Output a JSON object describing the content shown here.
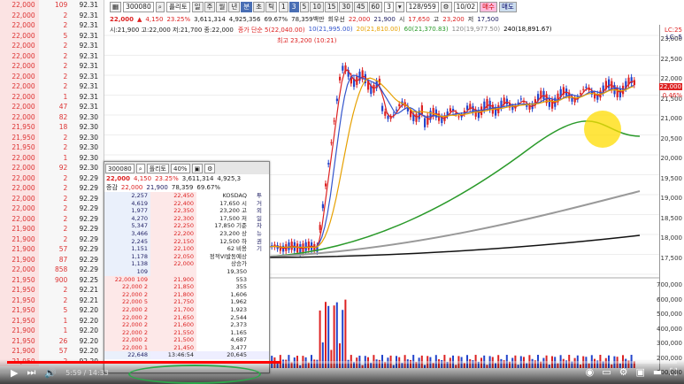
{
  "left_panel": {
    "rows": [
      [
        "22,000",
        "109",
        "92.31"
      ],
      [
        "22,000",
        "2",
        "92.31"
      ],
      [
        "22,000",
        "2",
        "92.31"
      ],
      [
        "22,000",
        "5",
        "92.31"
      ],
      [
        "22,000",
        "2",
        "92.31"
      ],
      [
        "22,000",
        "2",
        "92.31"
      ],
      [
        "22,000",
        "2",
        "92.31"
      ],
      [
        "22,000",
        "2",
        "92.31"
      ],
      [
        "22,000",
        "2",
        "92.31"
      ],
      [
        "22,000",
        "1",
        "92.31"
      ],
      [
        "22,000",
        "47",
        "92.31"
      ],
      [
        "22,000",
        "82",
        "92.30"
      ],
      [
        "21,950",
        "18",
        "92.30"
      ],
      [
        "21,950",
        "2",
        "92.30"
      ],
      [
        "21,950",
        "2",
        "92.30"
      ],
      [
        "22,000",
        "1",
        "92.30"
      ],
      [
        "22,000",
        "92",
        "92.30"
      ],
      [
        "22,000",
        "2",
        "92.29"
      ],
      [
        "22,000",
        "2",
        "92.29"
      ],
      [
        "22,000",
        "2",
        "92.29"
      ],
      [
        "22,000",
        "2",
        "92.29"
      ],
      [
        "22,000",
        "2",
        "92.29"
      ],
      [
        "21,900",
        "2",
        "92.29"
      ],
      [
        "21,900",
        "2",
        "92.29"
      ],
      [
        "21,900",
        "57",
        "92.29"
      ],
      [
        "21,900",
        "87",
        "92.29"
      ],
      [
        "22,000",
        "858",
        "92.29"
      ],
      [
        "21,950",
        "900",
        "92.25"
      ],
      [
        "21,950",
        "2",
        "92.21"
      ],
      [
        "21,950",
        "2",
        "92.21"
      ],
      [
        "21,950",
        "5",
        "92.20"
      ],
      [
        "21,950",
        "1",
        "92.20"
      ],
      [
        "21,900",
        "1",
        "92.20"
      ],
      [
        "21,950",
        "26",
        "92.20"
      ],
      [
        "21,900",
        "57",
        "92.20"
      ],
      [
        "21,950",
        "2",
        "92.20"
      ]
    ]
  },
  "toolbar": {
    "code": "300080",
    "name": "플리토",
    "periods": [
      "일",
      "주",
      "월",
      "년",
      "분",
      "초",
      "틱"
    ],
    "intervals": [
      "1",
      "3",
      "5",
      "10",
      "15",
      "30",
      "45",
      "60"
    ],
    "count": "3",
    "page": "128/959",
    "date": "10/02",
    "buy": "매수",
    "sell": "매도"
  },
  "quote": {
    "price": "22,000",
    "change": "4,150",
    "pct": "23.25%",
    "volume": "3,611,314",
    "vol2": "4,925,356",
    "ratio": "69.67%",
    "amount": "78,359백만",
    "tag": "회우선",
    "open_label": "시",
    "open": "17,650",
    "high_label": "고",
    "high": "23,200",
    "low_label": "저",
    "low": "17,500",
    "cur": "22,000",
    "cur2": "21,900"
  },
  "ohlc": {
    "text": "시:21,900 고:22,000 저:21,700 종:22,000"
  },
  "ma_legend": [
    {
      "text": "종가 단순 5(22,040.00)",
      "color": "#d22"
    },
    {
      "text": "10(21,995.00)",
      "color": "#3355cc"
    },
    {
      "text": "20(21,810.00)",
      "color": "#e6a000"
    },
    {
      "text": "60(21,370.83)",
      "color": "#2a9a2a"
    },
    {
      "text": "120(19,977.50)",
      "color": "#888888"
    },
    {
      "text": "240(18,891.67)",
      "color": "#000000"
    }
  ],
  "high_label": "최고 23,200 (10:21)",
  "yaxis": {
    "labels": [
      "23,000",
      "22,500",
      "22,000",
      "21,500",
      "21,000",
      "20,500",
      "20,000",
      "19,500",
      "19,000",
      "18,500",
      "18,000",
      "17,500",
      "700,000",
      "600,000",
      "500,000",
      "400,000",
      "300,000",
      "200,000",
      "100,000"
    ],
    "current": "22,000",
    "pct": "0.46%",
    "top": "LC:25",
    "top2": "LC:-5"
  },
  "xaxis": {
    "label": "10"
  },
  "mini": {
    "code": "300080",
    "name": "플리토",
    "ratio_tag": "40%",
    "price": "22,000",
    "change": "4,150",
    "pct": "23.25%",
    "volume": "3,611,314",
    "vol2": "4,925,3",
    "label_prev": "증감",
    "cur_a": "22,000",
    "cur_b": "21,900",
    "amount": "78,359",
    "ratio": "69.67%",
    "asks": [
      [
        "2,257",
        "22,450"
      ],
      [
        "4,619",
        "22,400"
      ],
      [
        "1,977",
        "22,350"
      ],
      [
        "4,270",
        "22,300"
      ],
      [
        "5,347",
        "22,250"
      ],
      [
        "3,466",
        "22,200"
      ],
      [
        "2,245",
        "22,150"
      ],
      [
        "1,151",
        "22,100"
      ],
      [
        "1,178",
        "22,050"
      ],
      [
        "1,138",
        "22,000"
      ]
    ],
    "info": [
      "KOSDAQ",
      "17,650 시",
      "23,200 고",
      "17,500 저",
      "17,850 기준",
      "23,200 상",
      "12,500 하",
      "62 비용",
      "정적VI발동예상",
      "상승가",
      "하락가"
    ],
    "side_tabs": [
      "투",
      "거",
      "외",
      "일",
      "차",
      "뉴",
      "권",
      "기"
    ],
    "bid_count": "109",
    "lowrate": "19,350",
    "ticks": [
      [
        "22,000",
        "109",
        "21,900",
        "553"
      ],
      [
        "22,000",
        "2",
        "21,850",
        "355"
      ],
      [
        "22,000",
        "2",
        "21,800",
        "1,606"
      ],
      [
        "22,000",
        "5",
        "21,750",
        "1,962"
      ],
      [
        "22,000",
        "2",
        "21,700",
        "1,923"
      ],
      [
        "22,000",
        "2",
        "21,650",
        "2,544"
      ],
      [
        "22,000",
        "2",
        "21,600",
        "2,373"
      ],
      [
        "22,000",
        "2",
        "21,550",
        "1,165"
      ],
      [
        "22,000",
        "2",
        "21,500",
        "4,687"
      ],
      [
        "22,000",
        "1",
        "21,450",
        "3,477"
      ]
    ],
    "footer": [
      "22,648",
      "13:46:54",
      "20,645"
    ]
  },
  "player": {
    "time": "5:59 / 14:33",
    "progress_pct": 41
  }
}
